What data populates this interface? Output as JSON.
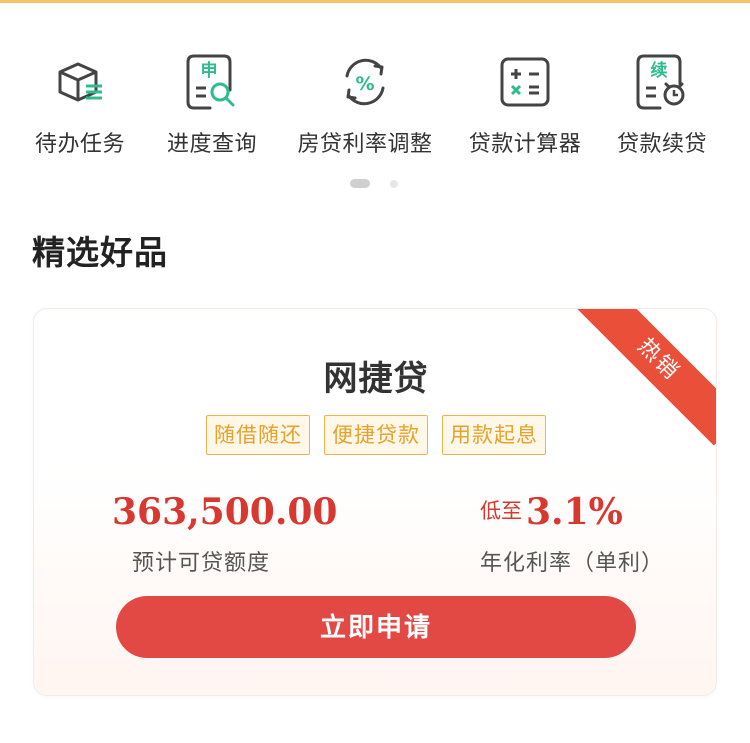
{
  "quick_menu": {
    "items": [
      {
        "label": "待办任务",
        "icon": "box-list-icon"
      },
      {
        "label": "进度查询",
        "icon": "application-search-icon",
        "icon_text": "申"
      },
      {
        "label": "房贷利率调整",
        "icon": "percent-refresh-icon",
        "icon_text": "%"
      },
      {
        "label": "贷款计算器",
        "icon": "calculator-icon"
      },
      {
        "label": "贷款续贷",
        "icon": "renewal-clock-icon",
        "icon_text": "续"
      }
    ],
    "pager": {
      "pages": 2,
      "current": 1
    }
  },
  "section": {
    "title": "精选好品"
  },
  "product": {
    "badge": "热销",
    "name": "网捷贷",
    "tags": [
      "随借随还",
      "便捷贷款",
      "用款起息"
    ],
    "amount": "363,500.00",
    "amount_label": "预计可贷额度",
    "rate_prefix": "低至",
    "rate_value": "3.1%",
    "rate_label": "年化利率（单利）",
    "apply_label": "立即申请"
  },
  "colors": {
    "accent_red": "#e34944",
    "tag_orange": "#f0b24a",
    "icon_dark": "#444444",
    "icon_green": "#2dbd8d",
    "top_line": "#f5c26b"
  }
}
